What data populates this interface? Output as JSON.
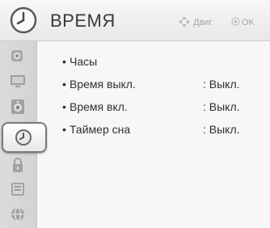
{
  "header": {
    "title": "ВРЕМЯ",
    "hint_move": "Двиг",
    "hint_ok": "OK"
  },
  "sidebar": {
    "items": [
      {
        "name": "picture",
        "icon": "picture-settings-icon"
      },
      {
        "name": "display",
        "icon": "tv-screen-icon"
      },
      {
        "name": "sound",
        "icon": "speaker-icon"
      },
      {
        "name": "time",
        "icon": "clock-icon",
        "selected": true
      },
      {
        "name": "lock",
        "icon": "lock-icon"
      },
      {
        "name": "options",
        "icon": "options-icon"
      },
      {
        "name": "network",
        "icon": "network-icon"
      }
    ]
  },
  "menu": {
    "items": [
      {
        "label": "Часы",
        "value": ""
      },
      {
        "label": "Время выкл.",
        "value": ": Выкл."
      },
      {
        "label": "Время вкл.",
        "value": ": Выкл."
      },
      {
        "label": "Таймер сна",
        "value": ": Выкл."
      }
    ],
    "bullet": "•"
  },
  "colors": {
    "title": "#3a3a3a",
    "hint": "#9ea6ad",
    "selected_border": "#7a7a7a"
  }
}
